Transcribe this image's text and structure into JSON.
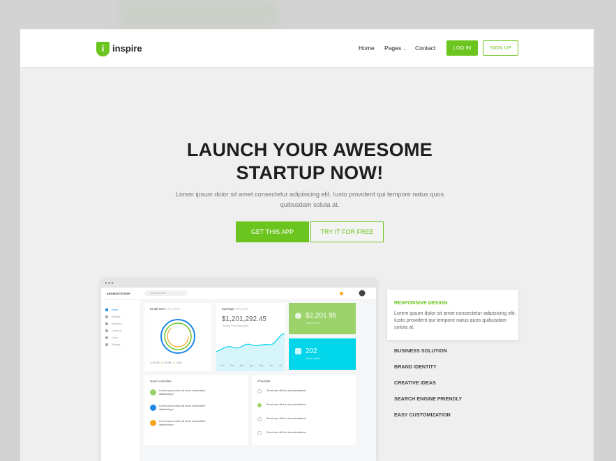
{
  "nav": {
    "logo_letter": "i",
    "brand": "inspire",
    "links": [
      "Home",
      "Pages",
      "Contact"
    ],
    "pages_chevron": "chevron-down-icon",
    "login": "LOG IN",
    "signup": "SIGN UP"
  },
  "hero": {
    "title_line1": "LAUNCH YOUR AWESOME",
    "title_line2": "STARTUP NOW!",
    "subtitle": "Lorem ipsum dolor sit amet consectetur adipisicing elit. Iusto provident qui tempore natus quos quibusdam soluta at.",
    "cta_primary": "GET THIS APP",
    "cta_secondary": "TRY IT FOR FREE"
  },
  "mockup": {
    "brand": "ARCBOOTSTRAP",
    "search_placeholder": "Type to search",
    "sidebar": [
      "Home",
      "Settings",
      "Inventory",
      "Calendar",
      "Users",
      "Settings"
    ],
    "email_title": "Email Sent",
    "email_tag": "This week",
    "email_legend": [
      "10,282",
      "12,085",
      "2,093"
    ],
    "earnings_title": "Earnings",
    "earnings_tag": "This year",
    "earnings_value": "$1,201,292.45",
    "earnings_note": "Trading Price Aggregate",
    "earnings_months": [
      "Jan",
      "Feb",
      "Mar",
      "Apr",
      "May",
      "Jun",
      "Jul"
    ],
    "tile_green_value": "$2,201.95",
    "tile_green_label": "Total income",
    "tile_cyan_value": "202",
    "tile_cyan_label": "Active visitors",
    "activities_title": "Users Activities",
    "activities": [
      "Lorem ipsum dolor sit amet consectetur adipisicing e",
      "Lorem ipsum dolor sit amet consectetur adipisicing e",
      "Lorem ipsum dolor sit amet consectetur adipisicing e"
    ],
    "checklist_title": "Checklist",
    "checklist": [
      "Send over all the documentations",
      "Send over all the documentations",
      "Send over all the documentations",
      "Send over all the documentations"
    ],
    "colors": {
      "accent": "#6cc51e",
      "blue": "#1e88e5",
      "cyan": "#00d5ea",
      "green_tile": "#9bd36a",
      "orange": "#f5a623"
    }
  },
  "features": {
    "active_title": "RESPONSIVE DESIGN",
    "active_text": "Lorem ipsum dolor sit amet consectetur adipisicing elit. Iusto provident qui tempore natus quos quibusdam soluta at.",
    "items": [
      "BUSINESS SOLUTION",
      "BRAND IDENTITY",
      "CREATIVE IDEAS",
      "SEARCH ENGINE FRIENDLY",
      "EASY CUSTOMIZATION"
    ]
  }
}
